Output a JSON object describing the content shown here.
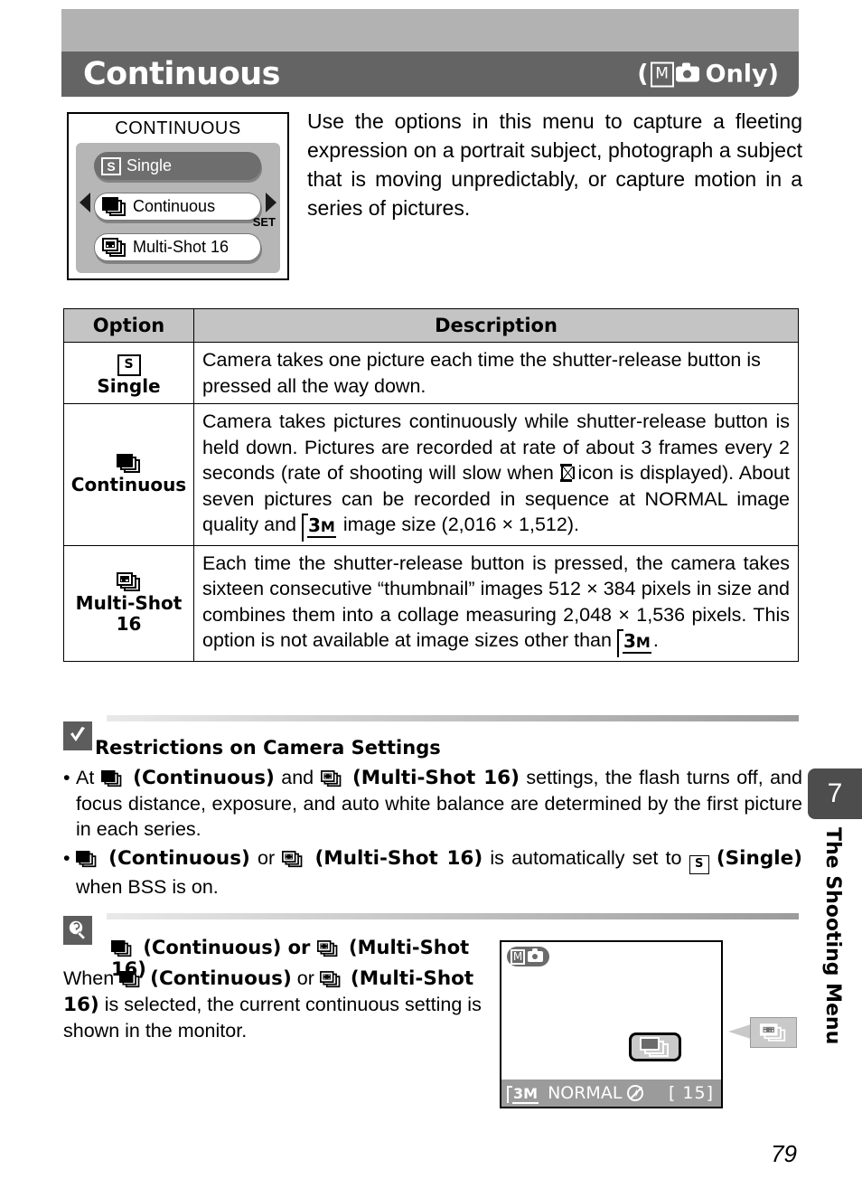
{
  "header": {
    "title": "Continuous",
    "mode_note_open": "(",
    "mode_letter": "M",
    "mode_note_close": "Only)",
    "band_color": "#b2b2b2",
    "bar_color": "#646464"
  },
  "menu_screenshot": {
    "title": "CONTINUOUS",
    "set_label": "SET",
    "items": [
      {
        "label": "Single",
        "icon": "single-s-icon",
        "selected": true
      },
      {
        "label": "Continuous",
        "icon": "continuous-stack-icon",
        "selected": false
      },
      {
        "label": "Multi-Shot 16",
        "icon": "multishot-grid-stack-icon",
        "selected": false
      }
    ]
  },
  "intro": {
    "text": "Use the options in this menu to capture a fleeting expression on a portrait subject, photograph a subject that is moving unpredictably, or capture motion in a series of pictures."
  },
  "table": {
    "headers": [
      "Option",
      "Description"
    ],
    "rows": [
      {
        "option": "Single",
        "icon": "single-s-icon",
        "description": "Camera takes one picture each time the shutter-release button is pressed all the way down."
      },
      {
        "option": "Continuous",
        "icon": "continuous-stack-icon",
        "desc_p1": "Camera takes pictures continuously while shutter-release button is held down. Pictures are recorded at rate of about 3 frames every 2 seconds (rate of shooting will slow when",
        "desc_p2": "icon is displayed). About seven pictures can be recorded in sequence at NORMAL image quality and",
        "desc_p3": "image size (2,016 × 1,512)."
      },
      {
        "option": "Multi-Shot 16",
        "option_line1": "Multi-Shot",
        "option_line2": "16",
        "icon": "multishot-grid-stack-icon",
        "desc_p1": "Each time the shutter-release button is pressed, the camera takes sixteen consecutive “thumbnail” images 512 × 384 pixels in size and combines them into a collage measuring 2,048 × 1,536 pixels. This option is not available at image sizes other than",
        "desc_p2": "."
      }
    ]
  },
  "note_restrictions": {
    "badge_icon": "checkmark-icon",
    "heading": "Restrictions on Camera Settings",
    "bullet1": {
      "t1": "At",
      "t2": "(Continuous)",
      "t3": "and",
      "t4": "(Multi-Shot 16)",
      "t5": "settings, the flash turns off, and focus distance, exposure, and auto white balance are determined by the first picture in each series."
    },
    "bullet2": {
      "t1": "(Continuous)",
      "t2": "or",
      "t3": "(Multi-Shot 16)",
      "t4": "is automatically set to",
      "t5": "(Single)",
      "t6": "when BSS is on."
    }
  },
  "note_tip": {
    "badge_icon": "lightbulb-icon",
    "heading_t1": "(Continuous) or",
    "heading_t2": "(Multi-Shot 16)",
    "body_t1": "When",
    "body_t2": "(Continuous)",
    "body_t3": "or",
    "body_t4": "(Multi-Shot 16)",
    "body_t5": "is selected, the current continuous setting is shown in the monitor."
  },
  "monitor": {
    "mode_letter": "M",
    "mode_icon": "camera-icon",
    "indicator_icon": "continuous-stack-icon",
    "callout_icon": "multishot-grid-stack-icon",
    "status": {
      "image_size": "3M",
      "quality": "NORMAL",
      "flash_icon": "flash-off-icon",
      "shots_remaining": "[ 15]"
    }
  },
  "side_tab": {
    "number": "7",
    "label": "The Shooting Menu"
  },
  "page_number": "79"
}
